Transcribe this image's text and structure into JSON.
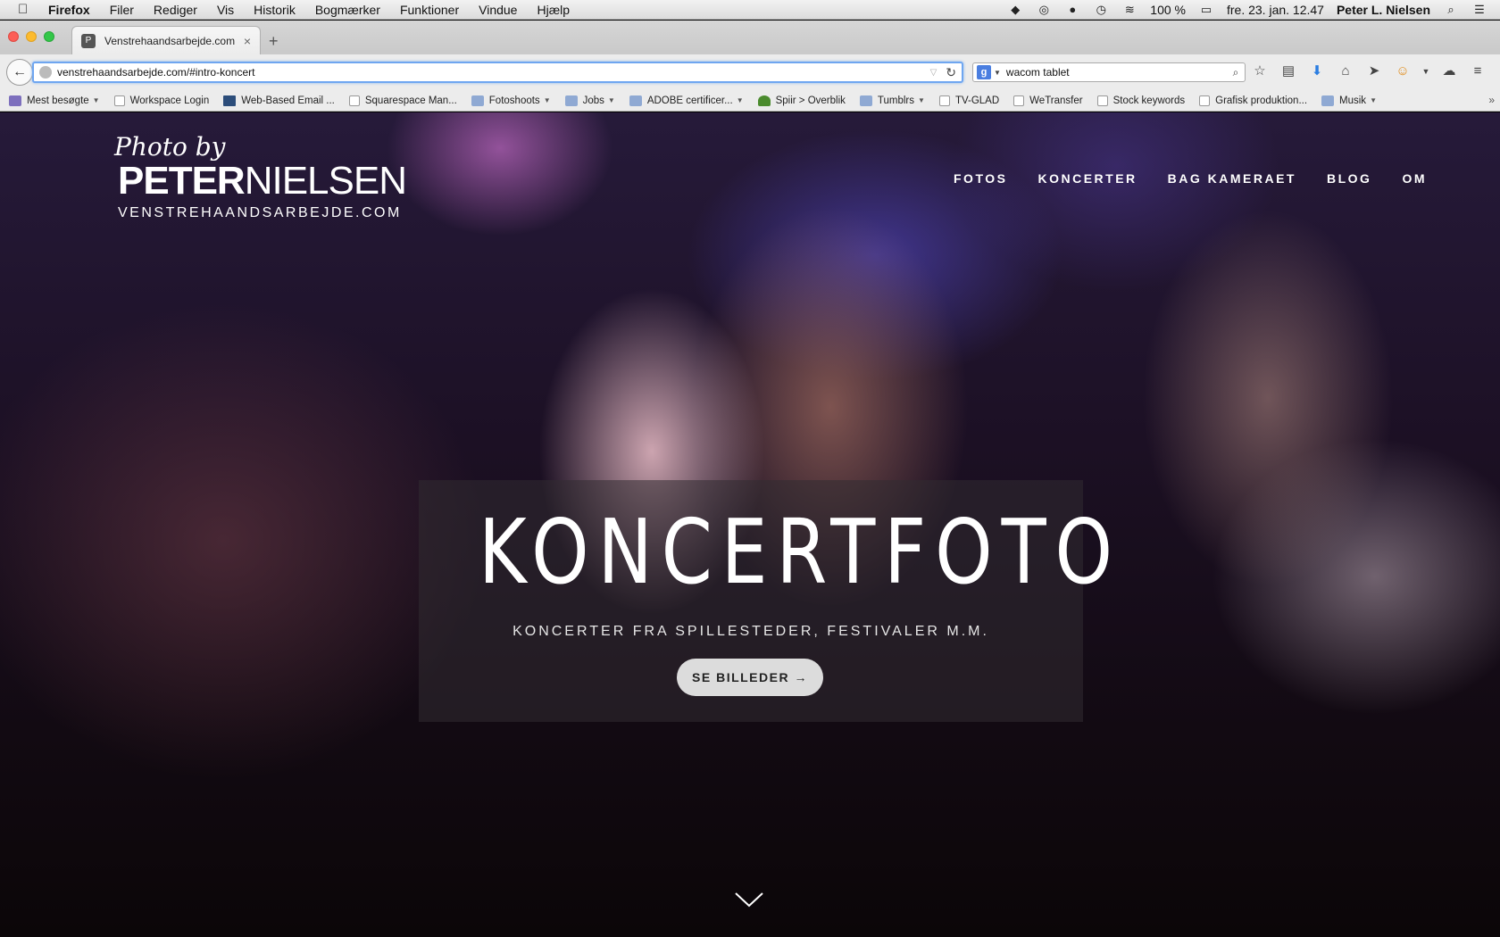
{
  "menubar": {
    "app_name": "Firefox",
    "menus": [
      "Filer",
      "Rediger",
      "Vis",
      "Historik",
      "Bogmærker",
      "Funktioner",
      "Vindue",
      "Hjælp"
    ],
    "battery": "100 %",
    "clock": "fre. 23. jan. 12.47",
    "user": "Peter L. Nielsen",
    "status_icons": [
      "dropbox-icon",
      "creative-cloud-icon",
      "app-icon",
      "time-machine-icon",
      "wifi-icon",
      "battery-icon",
      "spotlight-icon",
      "notification-center-icon"
    ]
  },
  "tab": {
    "title": "Venstrehaandsarbejde.com",
    "close": "×",
    "new_tab": "+"
  },
  "navbar": {
    "back": "←",
    "url": "venstrehaandsarbejde.com/#intro-koncert",
    "search_value": "wacom tablet",
    "search_engine": "g"
  },
  "bookmarks": [
    {
      "label": "Mest besøgte",
      "icon": "special",
      "dropdown": true
    },
    {
      "label": "Workspace Login",
      "icon": "page",
      "dropdown": false
    },
    {
      "label": "Web-Based Email ...",
      "icon": "mail",
      "dropdown": false
    },
    {
      "label": "Squarespace Man...",
      "icon": "page",
      "dropdown": false
    },
    {
      "label": "Fotoshoots",
      "icon": "folder",
      "dropdown": true
    },
    {
      "label": "Jobs",
      "icon": "folder",
      "dropdown": true
    },
    {
      "label": "ADOBE certificer...",
      "icon": "folder",
      "dropdown": true
    },
    {
      "label": "Spiir > Overblik",
      "icon": "leaf",
      "dropdown": false
    },
    {
      "label": "Tumblrs",
      "icon": "folder",
      "dropdown": true
    },
    {
      "label": "TV-GLAD",
      "icon": "page",
      "dropdown": false
    },
    {
      "label": "WeTransfer",
      "icon": "page",
      "dropdown": false
    },
    {
      "label": "Stock keywords",
      "icon": "page",
      "dropdown": false
    },
    {
      "label": "Grafisk produktion...",
      "icon": "page",
      "dropdown": false
    },
    {
      "label": "Musik",
      "icon": "folder",
      "dropdown": true
    }
  ],
  "site": {
    "logo": {
      "script": "Photo by",
      "name_bold": "PETER",
      "name_light": "NIELSEN",
      "domain": "VENSTREHAANDSARBEJDE.COM"
    },
    "nav": [
      "FOTOS",
      "KONCERTER",
      "BAG KAMERAET",
      "BLOG",
      "OM"
    ],
    "hero": {
      "title": "KONCERTFOTO",
      "subtitle": "KONCERTER FRA SPILLESTEDER, FESTIVALER M.M.",
      "button": "SE BILLEDER →"
    }
  }
}
